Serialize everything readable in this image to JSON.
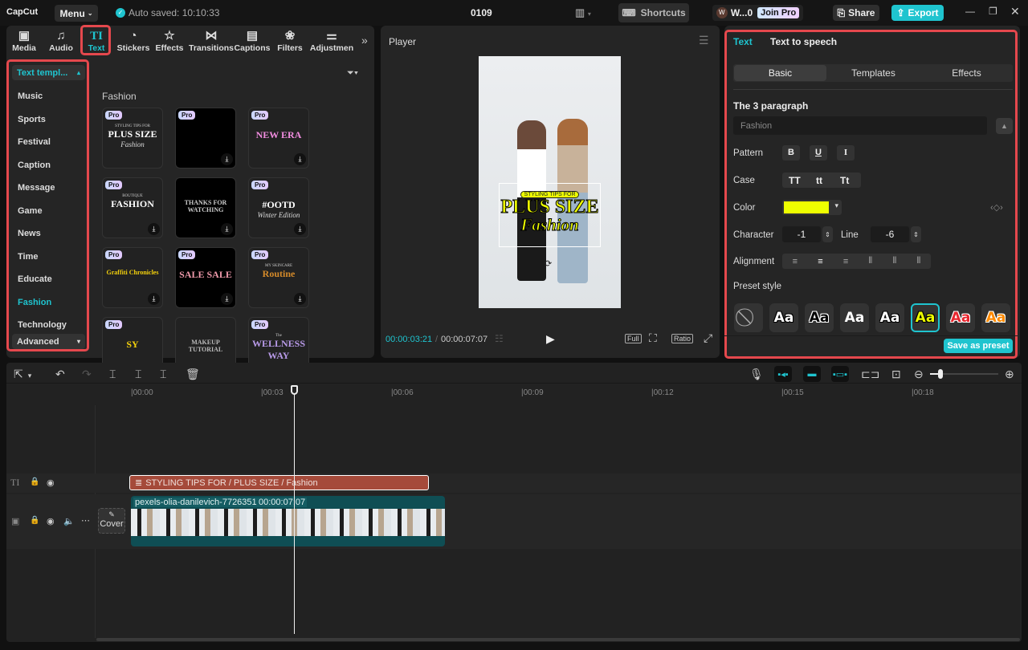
{
  "app": {
    "logo": "CapCut",
    "menu": "Menu",
    "autosave": "Auto saved: 10:10:33",
    "project": "0109",
    "shortcuts": "Shortcuts",
    "user_avatar": "W",
    "user": "W...0",
    "join_pro": "Join Pro",
    "share": "Share",
    "export": "Export"
  },
  "toolbar": {
    "tabs": [
      {
        "label": "Media",
        "icon": "media-icon"
      },
      {
        "label": "Audio",
        "icon": "audio-icon"
      },
      {
        "label": "Text",
        "icon": "text-icon",
        "active": true
      },
      {
        "label": "Stickers",
        "icon": "sticker-icon"
      },
      {
        "label": "Effects",
        "icon": "effects-icon"
      },
      {
        "label": "Transitions",
        "icon": "transitions-icon"
      },
      {
        "label": "Captions",
        "icon": "captions-icon"
      },
      {
        "label": "Filters",
        "icon": "filters-icon"
      },
      {
        "label": "Adjustmen",
        "icon": "adjustment-icon"
      }
    ]
  },
  "sidebar": {
    "header": "Text templ...",
    "items": [
      "Music",
      "Sports",
      "Festival",
      "Caption",
      "Message",
      "Game",
      "News",
      "Time",
      "Educate",
      "Fashion",
      "Technology"
    ],
    "active": "Fashion",
    "advanced": "Advanced"
  },
  "templates": {
    "section": "Fashion",
    "pro_badge": "Pro",
    "cards": [
      {
        "t1": "STYLING TIPS FOR",
        "t2": "PLUS SIZE",
        "t3": "Fashion",
        "pro": true,
        "dl": false
      },
      {
        "t1": "",
        "t2": "",
        "t3": "",
        "pro": true,
        "dl": true,
        "black": true
      },
      {
        "t1": "",
        "t2": "NEW ERA",
        "t3": "",
        "pro": true,
        "dl": true
      },
      {
        "t1": "BOUTIQUE",
        "t2": "FASHION",
        "t3": "",
        "pro": true,
        "dl": true
      },
      {
        "t1": "",
        "t2": "THANKS FOR WATCHING",
        "t3": "",
        "pro": false,
        "dl": true,
        "black": true
      },
      {
        "t1": "",
        "t2": "#OOTD",
        "t3": "Winter Edition",
        "pro": true,
        "dl": true
      },
      {
        "t1": "",
        "t2": "Graffiti Chronicles",
        "t3": "",
        "pro": true,
        "dl": true
      },
      {
        "t1": "",
        "t2": "SALE SALE",
        "t3": "",
        "pro": true,
        "dl": true,
        "black": true
      },
      {
        "t1": "MY SKINCARE",
        "t2": "Routine",
        "t3": "",
        "pro": true,
        "dl": true
      },
      {
        "t1": "",
        "t2": "SY",
        "t3": "",
        "pro": true,
        "dl": false
      },
      {
        "t1": "",
        "t2": "MAKEUP TUTORIAL",
        "t3": "",
        "pro": false,
        "dl": false
      },
      {
        "t1": "The",
        "t2": "WELLNESS WAY",
        "t3": "",
        "pro": true,
        "dl": false
      }
    ]
  },
  "player": {
    "title": "Player",
    "current": "00:00:03:21",
    "total": "00:00:07:07",
    "full": "Full",
    "ratio": "Ratio",
    "overlay": {
      "line1": "STYLING TIPS FOR",
      "line2": "PLUS SIZE",
      "line3": "Fashion"
    }
  },
  "inspector": {
    "tabs": [
      "Text",
      "Text to speech"
    ],
    "subtabs": [
      "Basic",
      "Templates",
      "Effects"
    ],
    "section": "The 3 paragraph",
    "text_value": "Fashion",
    "pattern_label": "Pattern",
    "pattern": [
      "B",
      "U",
      "I"
    ],
    "case_label": "Case",
    "case": [
      "TT",
      "tt",
      "Tt"
    ],
    "color_label": "Color",
    "color": "#eeff00",
    "character_label": "Character",
    "character": "-1",
    "line_label": "Line",
    "line": "-6",
    "alignment_label": "Alignment",
    "preset_label": "Preset style",
    "preset_sample": "Aa",
    "save_preset": "Save as preset"
  },
  "timeline": {
    "ticks": [
      "00:00",
      "00:03",
      "00:06",
      "00:09",
      "00:12",
      "00:15",
      "00:18"
    ],
    "text_clip": "STYLING TIPS FOR / PLUS SIZE / Fashion",
    "video_name": "pexels-olia-danilevich-7726351",
    "video_duration": "00:00:07:07",
    "cover": "Cover",
    "playhead_seconds": 3.7,
    "zoom_level": 0.15
  },
  "colors": {
    "accent": "#1fc4cf",
    "red_highlight": "#e5484d",
    "text_clip": "#a54a3a",
    "video_clip": "#0f4e54"
  }
}
